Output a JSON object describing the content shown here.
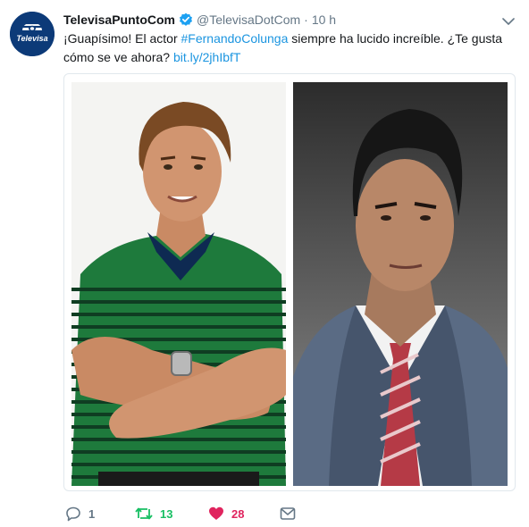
{
  "colors": {
    "link": "#1b95e0",
    "retweet_active": "#17bf63",
    "like_active": "#e0245e",
    "muted": "#657786",
    "verified_badge": "#1da1f2"
  },
  "tweet": {
    "author": {
      "display_name": "TelevisaPuntoCom",
      "verified": true,
      "handle": "@TelevisaDotCom",
      "avatar_logo_text": "Televisa"
    },
    "time": "10 h",
    "separator": "·",
    "text": {
      "part1": "¡Guapísimo! El actor ",
      "hashtag": "#FernandoColunga",
      "part2": " siempre ha lucido increíble. ¿Te gusta cómo se ve ahora? ",
      "link": "bit.ly/2jhIbfT"
    },
    "media": {
      "photos": [
        "then-photo",
        "now-photo"
      ]
    },
    "actions": {
      "reply_count": "1",
      "retweet_count": "13",
      "like_count": "28",
      "icons": [
        "reply-icon",
        "retweet-icon",
        "heart-icon",
        "message-icon"
      ]
    }
  }
}
